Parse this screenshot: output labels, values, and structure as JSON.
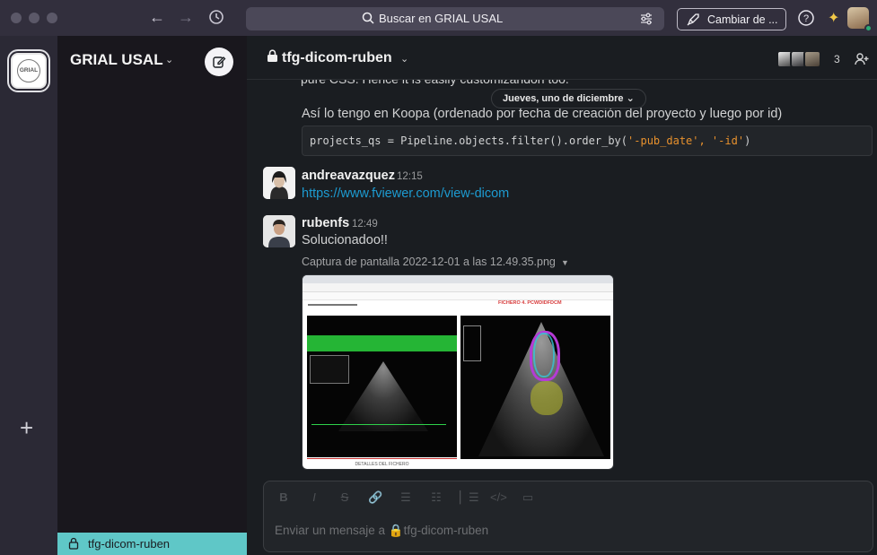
{
  "topbar": {
    "search_placeholder": "Buscar en GRIAL USAL",
    "upgrade_label": "Cambiar de ..."
  },
  "workspace": {
    "logo_text": "GRIAL",
    "name": "GRIAL USAL"
  },
  "channel": {
    "name": "tfg-dicom-ruben",
    "member_count": "3",
    "date_divider": "Jueves, uno de diciembre"
  },
  "sidebar": {
    "active_channel": "tfg-dicom-ruben"
  },
  "messages": {
    "partial_line": "pure CSS. Hence it is easily customizandon too.",
    "koopa_line": "Así lo tengo en Koopa (ordenado por fecha de creación del proyecto y luego por id)",
    "code_prefix": "projects_qs = Pipeline.objects.filter().order_by(",
    "code_args": "'-pub_date', '-id'",
    "code_suffix": ")",
    "andrea": {
      "author": "andreavazquez",
      "time": "12:15",
      "link": "https://www.fviewer.com/view-dicom"
    },
    "ruben": {
      "author": "rubenfs",
      "time": "12:49",
      "text": "Solucionadoo!!",
      "file_name": "Captura de pantalla 2022-12-01 a las 12.49.35.png",
      "shot_title": "FICHERO 4. PCWDIDFDCM",
      "shot_caption": "DETALLES DEL FICHERO"
    }
  },
  "composer": {
    "placeholder": "Enviar un mensaje a 🔒tfg-dicom-ruben"
  },
  "colors": {
    "topbar": "#322f3d",
    "sidebar": "#19171d",
    "active_channel": "#5fc7c7",
    "link": "#1d9bd1",
    "code": "#e8912d"
  }
}
